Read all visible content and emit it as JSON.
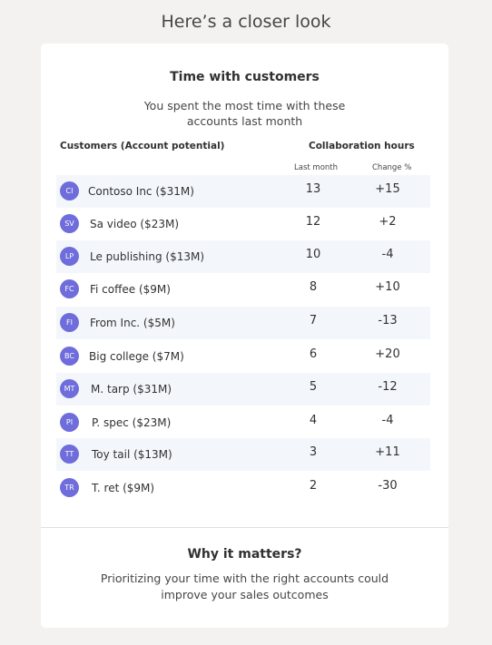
{
  "page": {
    "heading": "Here’s a closer look"
  },
  "card": {
    "title": "Time with customers",
    "subtitle": "You spent the most time with these accounts last month",
    "columns": {
      "customers": "Customers (Account potential)",
      "collaboration": "Collaboration hours",
      "last_month": "Last month",
      "change": "Change %"
    },
    "rows": [
      {
        "initials": "CI",
        "name": "Contoso Inc ($31M)",
        "hours": "13",
        "change": "+15"
      },
      {
        "initials": "SV",
        "name": "Sa video ($23M)",
        "hours": "12",
        "change": "+2"
      },
      {
        "initials": "LP",
        "name": "Le publishing ($13M)",
        "hours": "10",
        "change": "-4"
      },
      {
        "initials": "FC",
        "name": "Fi coffee ($9M)",
        "hours": "8",
        "change": "+10"
      },
      {
        "initials": "FI",
        "name": "From Inc. ($5M)",
        "hours": "7",
        "change": "-13"
      },
      {
        "initials": "BC",
        "name": "Big college ($7M)",
        "hours": "6",
        "change": "+20"
      },
      {
        "initials": "MT",
        "name": "M. tarp ($31M)",
        "hours": "5",
        "change": "-12"
      },
      {
        "initials": "PI",
        "name": "P. spec ($23M)",
        "hours": "4",
        "change": "-4"
      },
      {
        "initials": "TT",
        "name": "Toy tail ($13M)",
        "hours": "3",
        "change": "+11"
      },
      {
        "initials": "TR",
        "name": "T. ret ($9M)",
        "hours": "2",
        "change": "-30"
      }
    ],
    "why": {
      "title": "Why it matters?",
      "text": "Prioritizing your time with the right accounts could improve your sales outcomes"
    }
  },
  "colors": {
    "avatar": "#6f6cdb",
    "row_shade": "#f3f7fc",
    "page_bg": "#f3f2f1"
  }
}
